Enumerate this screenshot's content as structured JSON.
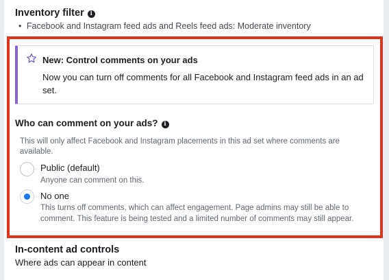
{
  "inventory_filter": {
    "title": "Inventory filter",
    "bullet": "•",
    "detail": "Facebook and Instagram feed ads and Reels feed ads: Moderate inventory"
  },
  "notice": {
    "icon": "star-outline-icon",
    "accent_color": "#8a64c9",
    "title": "New: Control comments on your ads",
    "body": "Now you can turn off comments for all Facebook and Instagram feed ads in an ad set."
  },
  "comment_control": {
    "title": "Who can comment on your ads?",
    "description": "This will only affect Facebook and Instagram placements in this ad set where comments are available.",
    "selected": "no_one",
    "options": [
      {
        "id": "public",
        "label": "Public (default)",
        "description": "Anyone can comment on this."
      },
      {
        "id": "no_one",
        "label": "No one",
        "description": "This turns off comments, which can affect engagement. Page admins may still be able to comment. This feature is being tested and a limited number of comments may still appear."
      }
    ]
  },
  "in_content": {
    "title": "In-content ad controls",
    "subtitle": "Where ads can appear in content"
  },
  "colors": {
    "highlight_border": "#e0331e",
    "radio_selected": "#1877f2"
  }
}
